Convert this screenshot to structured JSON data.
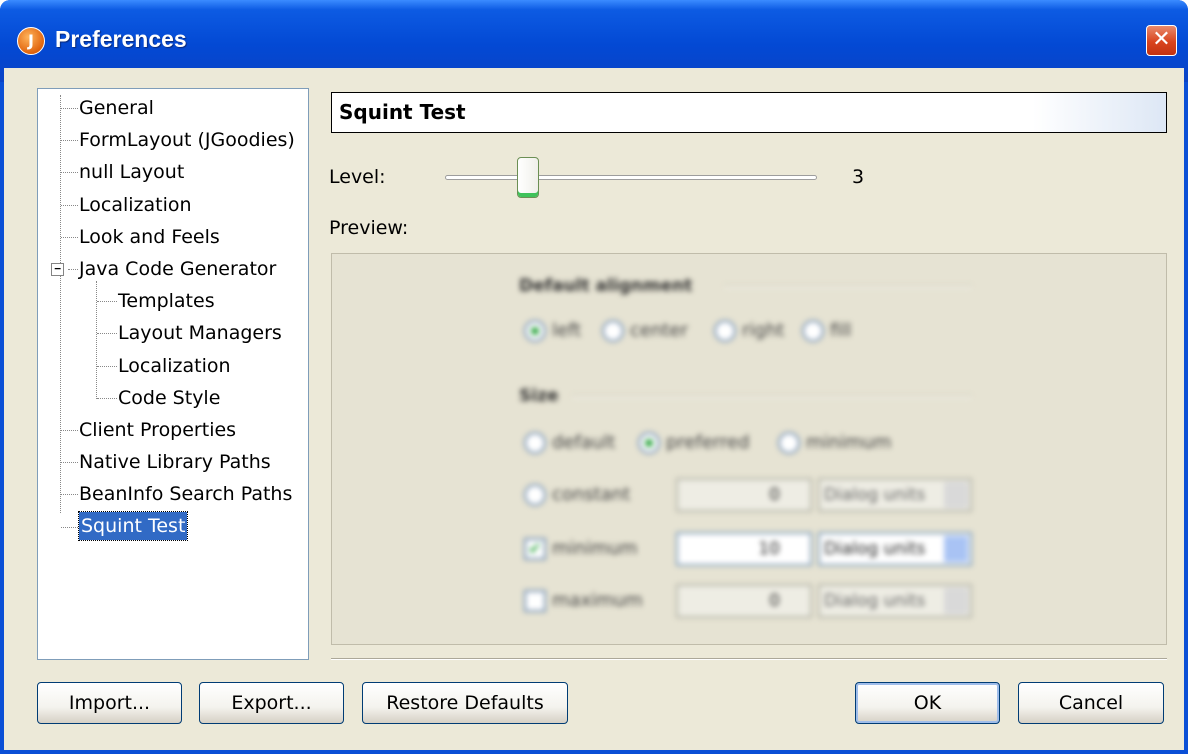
{
  "window": {
    "title": "Preferences",
    "app_icon": "J",
    "close_symbol": "✕"
  },
  "tree": {
    "expander_symbol": "−",
    "items": [
      {
        "label": "General"
      },
      {
        "label": "FormLayout (JGoodies)"
      },
      {
        "label": "null Layout"
      },
      {
        "label": "Localization"
      },
      {
        "label": "Look and Feels"
      },
      {
        "label": "Java Code Generator",
        "expanded": true
      },
      {
        "label": "Templates",
        "child": true
      },
      {
        "label": "Layout Managers",
        "child": true
      },
      {
        "label": "Localization",
        "child": true
      },
      {
        "label": "Code Style",
        "child": true
      },
      {
        "label": "Client Properties"
      },
      {
        "label": "Native Library Paths"
      },
      {
        "label": "BeanInfo Search Paths"
      },
      {
        "label": "Squint Test",
        "selected": true
      }
    ]
  },
  "panel": {
    "title": "Squint Test",
    "level_label": "Level:",
    "level_value": "3",
    "level_fraction": 0.2,
    "preview_label": "Preview:"
  },
  "preview": {
    "alignment_heading": "Default alignment",
    "alignment_options": [
      "left",
      "center",
      "right",
      "fill"
    ],
    "alignment_selected": "left",
    "size_heading": "Size",
    "size_options": [
      "default",
      "preferred",
      "minimum"
    ],
    "size_selected": "preferred",
    "constant_label": "constant",
    "minimum_label": "minimum",
    "maximum_label": "maximum",
    "minimum_checked": true,
    "maximum_checked": false,
    "constant_value": "0",
    "minimum_value": "10",
    "maximum_value": "0",
    "units": "Dialog units"
  },
  "buttons": {
    "import": "Import...",
    "export": "Export...",
    "restore": "Restore Defaults",
    "ok": "OK",
    "cancel": "Cancel"
  },
  "colors": {
    "titlebar": "#0349d4",
    "selection": "#316ac5",
    "dialog_bg": "#ece9d8"
  }
}
